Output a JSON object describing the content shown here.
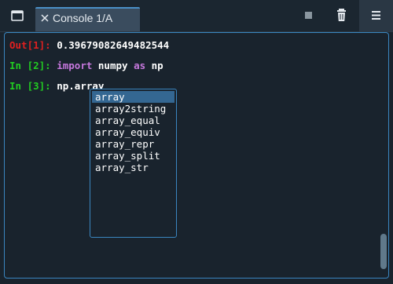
{
  "tab": {
    "label": "Console 1/A"
  },
  "icons": {
    "browse_tabs": "window-icon",
    "tab_close": "close-icon",
    "stop": "stop-icon",
    "remove": "trash-icon",
    "options": "hamburger-menu-icon"
  },
  "console": {
    "lines": [
      {
        "prompt": "Out[1]:",
        "prompt_type": "out",
        "code": " 0.39679082649482544"
      },
      {
        "prompt": "In [2]:",
        "prompt_type": "in",
        "keyword1": "import",
        "mid": " numpy ",
        "keyword2": "as",
        "end": " np"
      },
      {
        "prompt": "In [3]:",
        "prompt_type": "in",
        "code": " np.array"
      }
    ]
  },
  "completion": {
    "items": [
      "array",
      "array2string",
      "array_equal",
      "array_equiv",
      "array_repr",
      "array_split",
      "array_str"
    ],
    "selected_index": 0
  },
  "colors": {
    "background": "#19232d",
    "accent": "#3a86c0",
    "selection": "#346792",
    "out_prompt": "#e02020",
    "in_prompt": "#22cc22",
    "keyword": "#c678dd"
  }
}
